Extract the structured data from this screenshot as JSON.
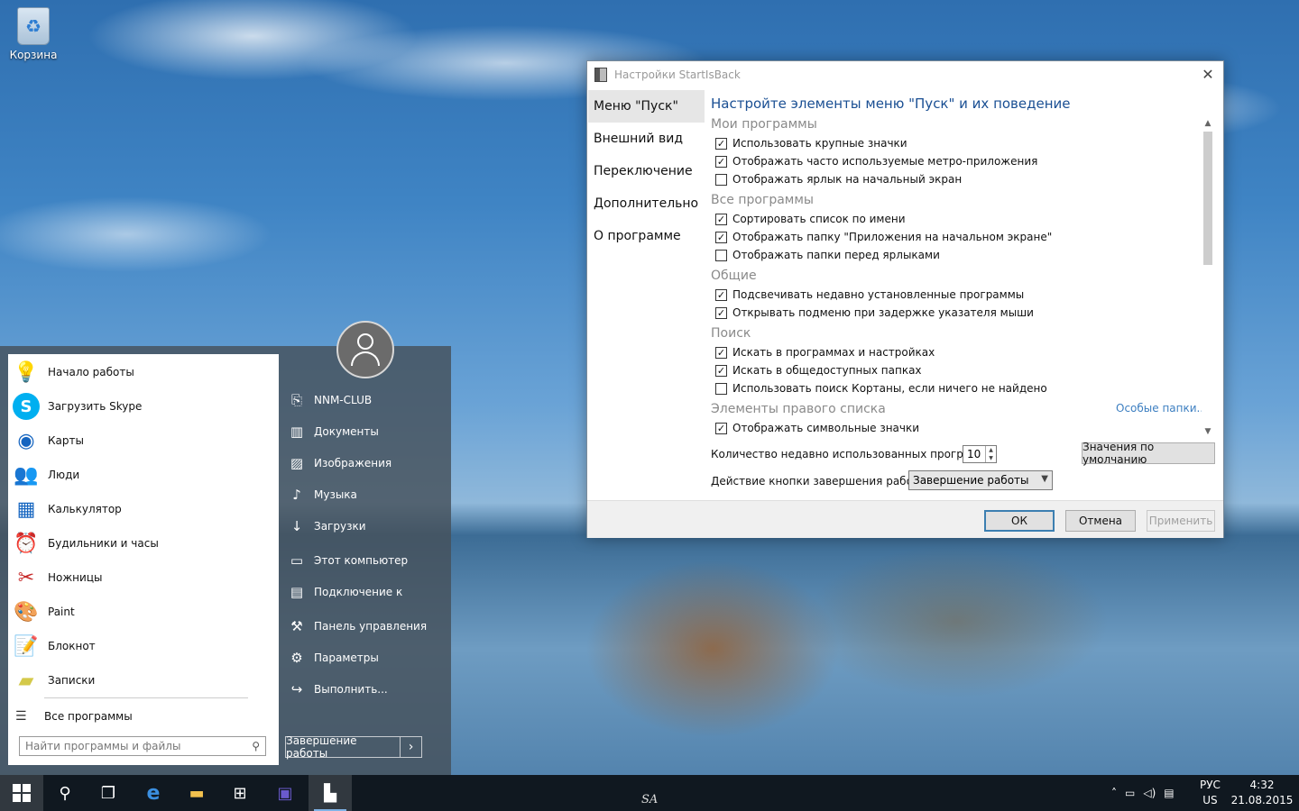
{
  "desktop": {
    "recycle_bin_label": "Корзина",
    "recycle_icon": "recycle-bin-icon"
  },
  "start_menu": {
    "programs": [
      {
        "label": "Начало работы",
        "icon": "lightbulb-icon"
      },
      {
        "label": "Загрузить Skype",
        "icon": "skype-icon"
      },
      {
        "label": "Карты",
        "icon": "maps-icon"
      },
      {
        "label": "Люди",
        "icon": "people-icon"
      },
      {
        "label": "Калькулятор",
        "icon": "calculator-icon"
      },
      {
        "label": "Будильники и часы",
        "icon": "alarm-clock-icon"
      },
      {
        "label": "Ножницы",
        "icon": "scissors-icon"
      },
      {
        "label": "Paint",
        "icon": "paint-palette-icon"
      },
      {
        "label": "Блокнот",
        "icon": "notepad-icon"
      },
      {
        "label": "Записки",
        "icon": "sticky-notes-icon"
      }
    ],
    "all_programs": "Все программы",
    "search_placeholder": "Найти программы и файлы",
    "places": [
      {
        "label": "NNM-CLUB",
        "icon": "user-folder-icon"
      },
      {
        "label": "Документы",
        "icon": "documents-icon"
      },
      {
        "label": "Изображения",
        "icon": "pictures-icon"
      },
      {
        "label": "Музыка",
        "icon": "music-icon"
      },
      {
        "label": "Загрузки",
        "icon": "downloads-icon"
      },
      {
        "label": "Этот компьютер",
        "icon": "computer-icon"
      },
      {
        "label": "Подключение к",
        "icon": "connect-icon"
      },
      {
        "label": "Панель управления",
        "icon": "control-panel-icon"
      },
      {
        "label": "Параметры",
        "icon": "settings-gear-icon"
      },
      {
        "label": "Выполнить...",
        "icon": "run-icon"
      }
    ],
    "shutdown_label": "Завершение работы"
  },
  "dialog": {
    "title": "Настройки StartIsBack",
    "nav": [
      "Меню \"Пуск\"",
      "Внешний вид",
      "Переключение",
      "Дополнительно",
      "О программе"
    ],
    "heading": "Настройте элементы меню \"Пуск\" и их поведение",
    "groups": [
      {
        "title": "Мои программы",
        "options": [
          {
            "label": "Использовать крупные значки",
            "checked": true
          },
          {
            "label": "Отображать часто используемые метро-приложения",
            "checked": true
          },
          {
            "label": "Отображать ярлык на начальный экран",
            "checked": false
          }
        ]
      },
      {
        "title": "Все программы",
        "options": [
          {
            "label": "Сортировать список по имени",
            "checked": true
          },
          {
            "label": "Отображать папку \"Приложения на начальном экране\"",
            "checked": true
          },
          {
            "label": "Отображать папки перед ярлыками",
            "checked": false
          }
        ]
      },
      {
        "title": "Общие",
        "options": [
          {
            "label": "Подсвечивать недавно установленные программы",
            "checked": true
          },
          {
            "label": "Открывать подменю при задержке указателя мыши",
            "checked": true
          }
        ]
      },
      {
        "title": "Поиск",
        "options": [
          {
            "label": "Искать в программах и настройках",
            "checked": true
          },
          {
            "label": "Искать в общедоступных папках",
            "checked": true
          },
          {
            "label": "Использовать поиск Кортаны, если ничего не найдено",
            "checked": false
          }
        ]
      },
      {
        "title": "Элементы правого списка",
        "options": [
          {
            "label": "Отображать символьные значки",
            "checked": true
          }
        ]
      }
    ],
    "special_folders_link": "Особые папки...",
    "recent_count_label": "Количество недавно использованных программ:",
    "recent_count_value": "10",
    "defaults_button": "Значения по умолчанию",
    "power_action_label": "Действие кнопки завершения работы:",
    "power_action_value": "Завершение работы",
    "ok": "ОК",
    "cancel": "Отмена",
    "apply": "Применить"
  },
  "taskbar": {
    "watermark": "SA",
    "language": "РУС",
    "layout": "US",
    "time": "4:32",
    "date": "21.08.2015",
    "accent": "#7fb2e5"
  }
}
